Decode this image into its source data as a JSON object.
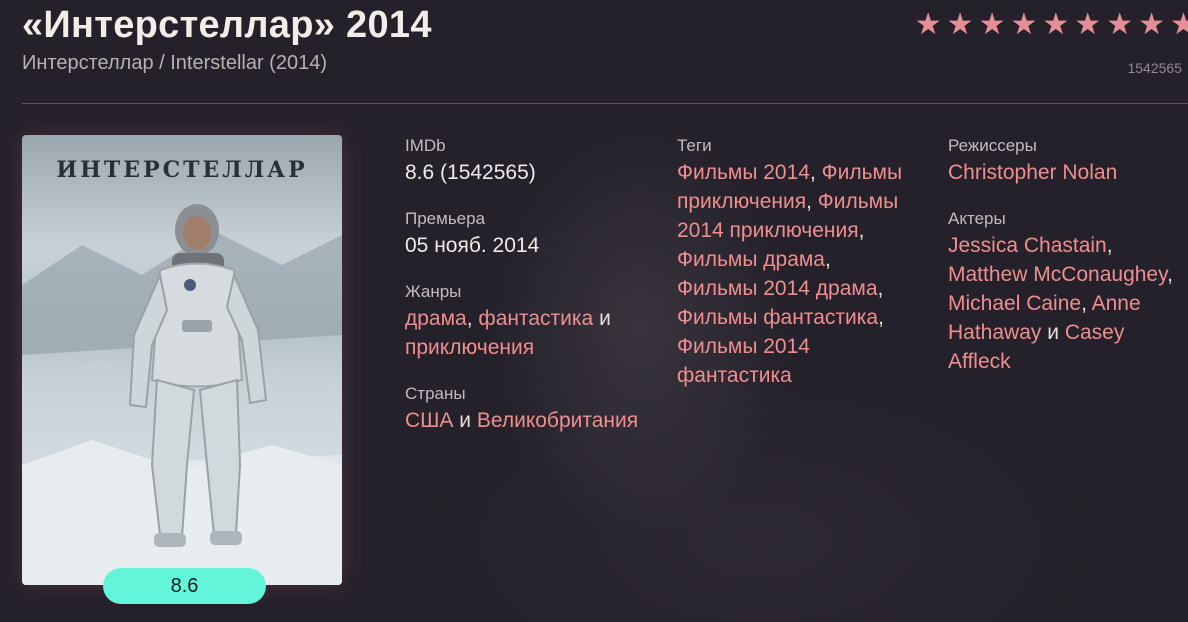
{
  "header": {
    "title": "«Интерстеллар» 2014",
    "subtitle": "Интерстеллар / Interstellar (2014)",
    "votes": "1542565",
    "rating_stars": 8.6
  },
  "poster": {
    "title_text": "ИНТЕРСТЕЛЛАР",
    "rating": "8.6"
  },
  "colors": {
    "accent": "#ee8e90",
    "rating_pill": "#63f5da",
    "background": "#25212a"
  },
  "details": {
    "imdb": {
      "label": "IMDb",
      "value": "8.6 (1542565)"
    },
    "premiere": {
      "label": "Премьера",
      "value": "05 нояб. 2014"
    },
    "genres": {
      "label": "Жанры",
      "items": [
        "драма",
        "фантастика",
        "приключения"
      ],
      "sep": ",",
      "and": "и"
    },
    "countries": {
      "label": "Страны",
      "items": [
        "США",
        "Великобритания"
      ],
      "and": "и"
    },
    "tags": {
      "label": "Теги",
      "items": [
        "Фильмы 2014",
        "Фильмы приключения",
        "Фильмы 2014 приключения",
        "Фильмы драма",
        "Фильмы 2014 драма",
        "Фильмы фантастика",
        "Фильмы 2014 фантастика"
      ],
      "sep": ","
    },
    "directors": {
      "label": "Режиссеры",
      "items": [
        "Christopher Nolan"
      ]
    },
    "actors": {
      "label": "Актеры",
      "items": [
        "Jessica Chastain",
        "Matthew McConaughey",
        "Michael Caine",
        "Anne Hathaway",
        "Casey Affleck"
      ],
      "sep": ",",
      "and": "и"
    }
  }
}
